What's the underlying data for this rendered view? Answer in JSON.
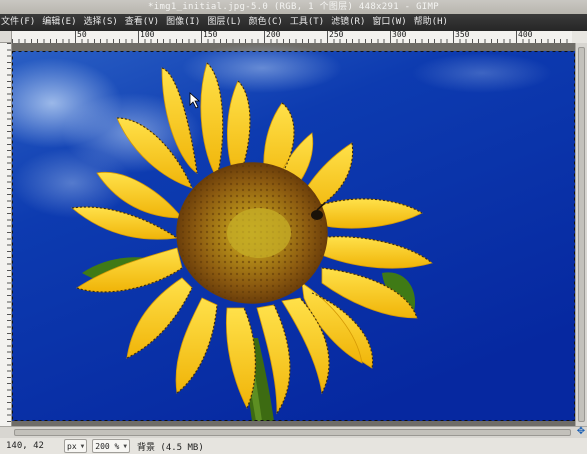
{
  "window": {
    "title": "*img1_initial.jpg-5.0 (RGB, 1 个图层) 448x291 - GIMP"
  },
  "menubar": {
    "items": [
      "文件(F)",
      "编辑(E)",
      "选择(S)",
      "查看(V)",
      "图像(I)",
      "图层(L)",
      "颜色(C)",
      "工具(T)",
      "滤镜(R)",
      "窗口(W)",
      "帮助(H)"
    ]
  },
  "ruler": {
    "labels": [
      "50",
      "100",
      "150",
      "200",
      "250",
      "300",
      "350",
      "400"
    ]
  },
  "canvas": {
    "image_description_icon": "sunflower-photo",
    "sky_color": "#0a2fa8",
    "petal_color": "#f6c313",
    "selection": "marching-ants around sunflower"
  },
  "statusbar": {
    "coords": "140, 42",
    "unit": "px",
    "zoom": "200 %",
    "message": "背景 (4.5 MB)"
  }
}
